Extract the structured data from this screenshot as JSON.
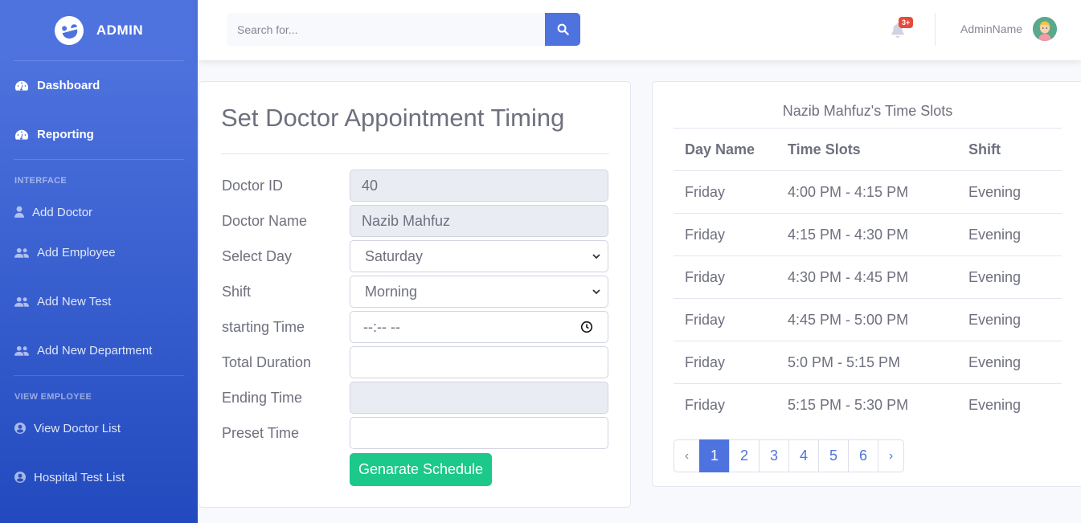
{
  "brand": {
    "name": "ADMIN"
  },
  "sidebar": {
    "top_items": [
      {
        "label": "Dashboard",
        "icon": "tachometer-icon"
      },
      {
        "label": "Reporting",
        "icon": "tachometer-icon"
      }
    ],
    "heading_interface": "INTERFACE",
    "interface_items": [
      {
        "label": "Add Doctor",
        "icon": "user-doctor-icon"
      },
      {
        "label": "Add Employee",
        "icon": "users-icon"
      },
      {
        "label": "Add New Test",
        "icon": "users-icon"
      },
      {
        "label": "Add New Department",
        "icon": "users-icon"
      }
    ],
    "heading_view": "VIEW EMPLOYEE",
    "view_items": [
      {
        "label": "View Doctor List",
        "icon": "user-circle-icon"
      },
      {
        "label": "Hospital Test List",
        "icon": "user-circle-icon"
      }
    ]
  },
  "topbar": {
    "search_placeholder": "Search for...",
    "alerts_badge": "3+",
    "username": "AdminName"
  },
  "form": {
    "title": "Set Doctor Appointment Timing",
    "fields": {
      "doctor_id": {
        "label": "Doctor ID",
        "value": "40"
      },
      "doctor_name": {
        "label": "Doctor Name",
        "value": "Nazib Mahfuz"
      },
      "select_day": {
        "label": "Select Day",
        "value": "Saturday"
      },
      "shift": {
        "label": "Shift",
        "value": "Morning"
      },
      "starting_time": {
        "label": "starting Time",
        "value": "--:-- --"
      },
      "total_duration": {
        "label": "Total Duration",
        "value": ""
      },
      "ending_time": {
        "label": "Ending Time",
        "value": ""
      },
      "preset_time": {
        "label": "Preset Time",
        "value": ""
      }
    },
    "submit_label": "Genarate Schedule"
  },
  "slots": {
    "caption": "Nazib Mahfuz's Time Slots",
    "headers": [
      "Day Name",
      "Time Slots",
      "Shift"
    ],
    "rows": [
      [
        "Friday",
        "4:00 PM - 4:15 PM",
        "Evening"
      ],
      [
        "Friday",
        "4:15 PM - 4:30 PM",
        "Evening"
      ],
      [
        "Friday",
        "4:30 PM - 4:45 PM",
        "Evening"
      ],
      [
        "Friday",
        "4:45 PM - 5:00 PM",
        "Evening"
      ],
      [
        "Friday",
        "5:0 PM - 5:15 PM",
        "Evening"
      ],
      [
        "Friday",
        "5:15 PM - 5:30 PM",
        "Evening"
      ]
    ]
  },
  "pagination": {
    "prev": "‹",
    "next": "›",
    "pages": [
      "1",
      "2",
      "3",
      "4",
      "5",
      "6"
    ],
    "active": "1"
  },
  "colors": {
    "primary": "#4e73df",
    "success": "#1cc88a",
    "danger": "#e74a3b",
    "text": "#6e707e"
  }
}
